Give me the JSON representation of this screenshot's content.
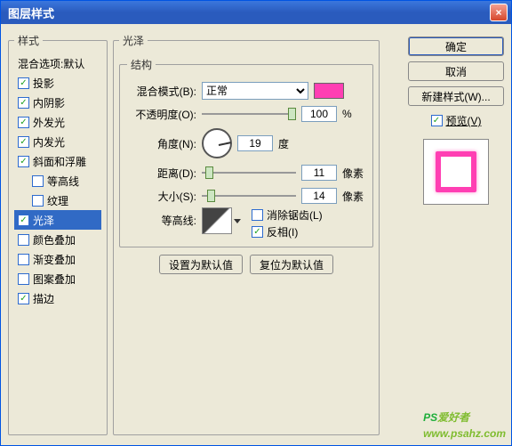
{
  "window": {
    "title": "图层样式"
  },
  "left": {
    "legend": "样式",
    "blend_header": "混合选项:默认",
    "items": [
      {
        "label": "投影",
        "checked": true
      },
      {
        "label": "内阴影",
        "checked": true
      },
      {
        "label": "外发光",
        "checked": true
      },
      {
        "label": "内发光",
        "checked": true
      },
      {
        "label": "斜面和浮雕",
        "checked": true
      },
      {
        "label": "等高线",
        "checked": false,
        "sub": true
      },
      {
        "label": "纹理",
        "checked": false,
        "sub": true
      },
      {
        "label": "光泽",
        "checked": true,
        "selected": true
      },
      {
        "label": "颜色叠加",
        "checked": false
      },
      {
        "label": "渐变叠加",
        "checked": false
      },
      {
        "label": "图案叠加",
        "checked": false
      },
      {
        "label": "描边",
        "checked": true
      }
    ]
  },
  "center": {
    "legend": "光泽",
    "struct_legend": "结构",
    "blend_mode_label": "混合模式(B):",
    "blend_mode_value": "正常",
    "swatch_color": "#ff3fb3",
    "opacity_label": "不透明度(O):",
    "opacity_value": "100",
    "opacity_unit": "%",
    "angle_label": "角度(N):",
    "angle_value": "19",
    "angle_unit": "度",
    "distance_label": "距离(D):",
    "distance_value": "11",
    "distance_unit": "像素",
    "size_label": "大小(S):",
    "size_value": "14",
    "size_unit": "像素",
    "contour_label": "等高线:",
    "antialias_label": "消除锯齿(L)",
    "invert_label": "反相(I)",
    "antialias_checked": false,
    "invert_checked": true,
    "reset_default": "设置为默认值",
    "restore_default": "复位为默认值"
  },
  "right": {
    "ok": "确定",
    "cancel": "取消",
    "new_style": "新建样式(W)...",
    "preview_label": "预览(V)",
    "preview_checked": true
  },
  "watermark": {
    "t1": "PS",
    "t2": "爱好者",
    "t3": "www.psahz.com"
  }
}
